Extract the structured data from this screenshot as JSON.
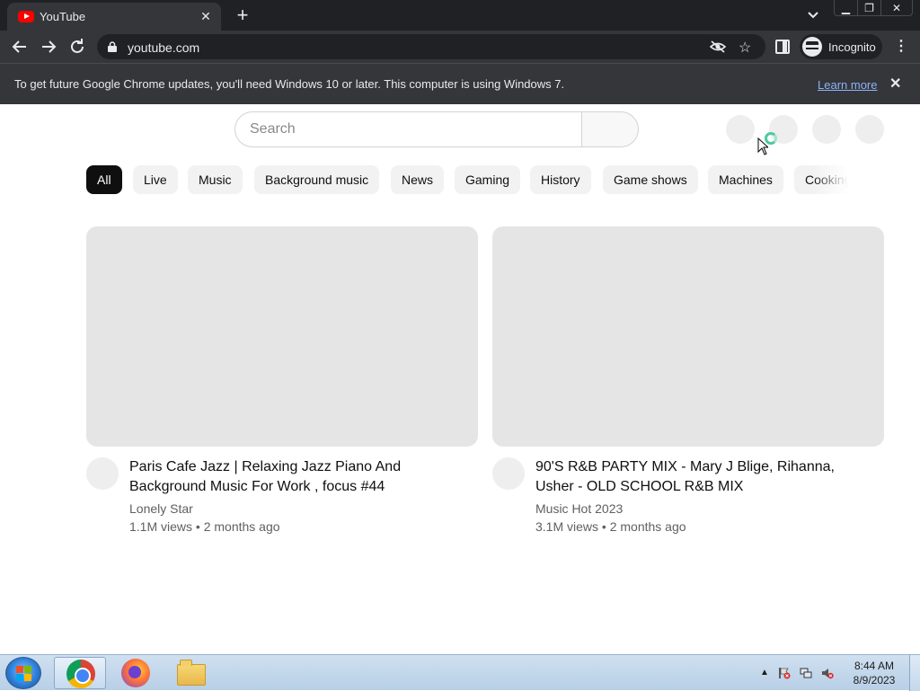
{
  "browser": {
    "tab_title": "YouTube",
    "url": "youtube.com",
    "profile_label": "Incognito"
  },
  "infobar": {
    "message": "To get future Google Chrome updates, you'll need Windows 10 or later. This computer is using Windows 7.",
    "link": "Learn more"
  },
  "youtube": {
    "search_placeholder": "Search",
    "chips": [
      {
        "label": "All",
        "active": true
      },
      {
        "label": "Live"
      },
      {
        "label": "Music"
      },
      {
        "label": "Background music"
      },
      {
        "label": "News"
      },
      {
        "label": "Gaming"
      },
      {
        "label": "History"
      },
      {
        "label": "Game shows"
      },
      {
        "label": "Machines"
      },
      {
        "label": "Cooking"
      }
    ],
    "videos": [
      {
        "title": "Paris Cafe Jazz | Relaxing Jazz Piano And Background Music For Work , focus #44",
        "channel": "Lonely Star",
        "meta": "1.1M views • 2 months ago"
      },
      {
        "title": "90'S R&B PARTY MIX - Mary J Blige, Rihanna, Usher - OLD SCHOOL R&B MIX",
        "channel": "Music Hot 2023",
        "meta": "3.1M views • 2 months ago"
      }
    ]
  },
  "taskbar": {
    "time": "8:44 AM",
    "date": "8/9/2023"
  },
  "colors": {
    "chrome_dark": "#202124",
    "chrome_toolbar": "#35363a",
    "chip_active": "#0f0f0f",
    "skeleton": "#e5e5e5",
    "link": "#8ab4f8"
  }
}
